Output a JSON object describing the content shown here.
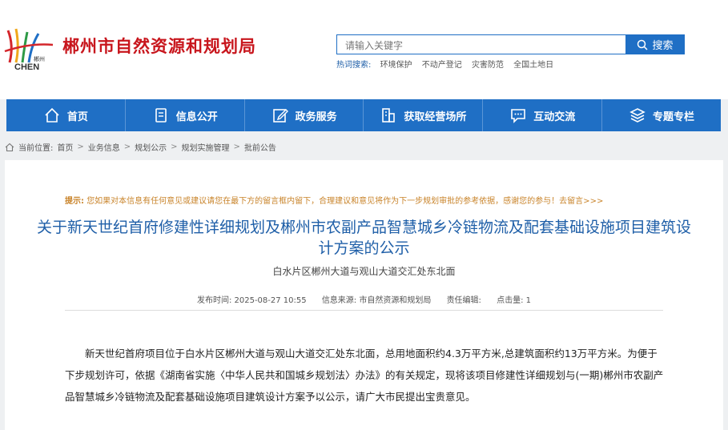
{
  "site": {
    "logo_text": "郴州 CHEN",
    "title": "郴州市自然资源和规划局"
  },
  "search": {
    "placeholder": "请输入关键字",
    "button_label": "搜索",
    "hot_label": "热词搜索:",
    "hot_links": [
      "环境保护",
      "不动产登记",
      "灾害防范",
      "全国土地日"
    ]
  },
  "nav": {
    "items": [
      {
        "label": "首页",
        "icon": "home-icon"
      },
      {
        "label": "信息公开",
        "icon": "document-icon"
      },
      {
        "label": "政务服务",
        "icon": "edit-icon"
      },
      {
        "label": "获取经营场所",
        "icon": "building-icon"
      },
      {
        "label": "互动交流",
        "icon": "chat-icon"
      },
      {
        "label": "专题专栏",
        "icon": "layers-icon"
      }
    ]
  },
  "breadcrumb": {
    "prefix": "当前位置:",
    "items": [
      "首页",
      "业务信息",
      "规划公示",
      "规划实施管理",
      "批前公告"
    ]
  },
  "article": {
    "tip_label": "提示:",
    "tip_text": "您如果对本信息有任何意见或建议请您在最下方的留言框内留下，合理建议和意见将作为下一步规划审批的参考依据，感谢您的参与！去留言>>>",
    "title": "关于新天世纪首府修建性详细规划及郴州市农副产品智慧城乡冷链物流及配套基础设施项目建筑设计方案的公示",
    "subtitle": "白水片区郴州大道与观山大道交汇处东北面",
    "meta": {
      "publish_time": "发布时间:  2025-08-27 10:55",
      "source": "信息来源:  市自然资源和规划局",
      "editor": "责任编辑:",
      "clicks": "点击量:  1"
    },
    "body": "新天世纪首府项目位于白水片区郴州大道与观山大道交汇处东北面，总用地面积约4.3万平方米,总建筑面积约13万平方米。为便于下步规划许可，依据《湖南省实施〈中华人民共和国城乡规划法〉办法》的有关规定，现将该项目修建性详细规划与(一期)郴州市农副产品智慧城乡冷链物流及配套基础设施项目建筑设计方案予以公示，请广大市民提出宝贵意见。"
  },
  "colors": {
    "brand_red": "#c8161d",
    "nav_blue": "#1f6fc5",
    "title_blue": "#1f5fa8",
    "tip_orange": "#c9842b"
  }
}
